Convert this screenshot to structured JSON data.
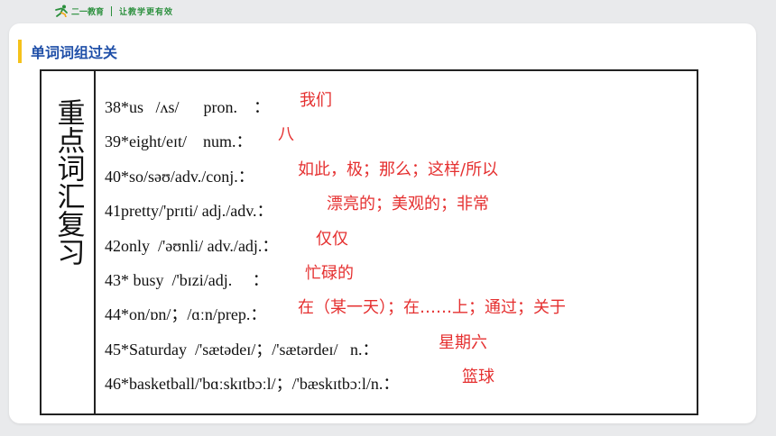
{
  "header": {
    "logo_name": "二一教育",
    "slogan": "让教学更有效"
  },
  "section": {
    "title": "单词词组过关"
  },
  "table": {
    "side_title": "重点词汇复习",
    "entries": [
      {
        "en": "38*us   /ʌs/      pron.    ：",
        "zh": "我们"
      },
      {
        "en": "39*eight/eɪt/    num.：",
        "zh": "八"
      },
      {
        "en": "40*so/səʊ/adv./conj.：",
        "zh": "如此，极；那么；这样/所以"
      },
      {
        "en": "41pretty/'prɪti/ adj./adv.：",
        "zh": "漂亮的；美观的；非常"
      },
      {
        "en": "42only  /'əʊnli/ adv./adj.：",
        "zh": "仅仅"
      },
      {
        "en": "43* busy  /'bɪzi/adj.     ：",
        "zh": "忙碌的"
      },
      {
        "en": "44*on/ɒn/；/ɑːn/prep.：",
        "zh": "在（某一天）；在……上；通过；关于"
      },
      {
        "en": "45*Saturday  /'sætədeɪ/；/'sætərdeɪ/   n.：",
        "zh": "星期六"
      },
      {
        "en": "46*basketball/'bɑːskɪtbɔːl/；/'bæskɪtbɔːl/n.：",
        "zh": "篮球"
      }
    ]
  }
}
